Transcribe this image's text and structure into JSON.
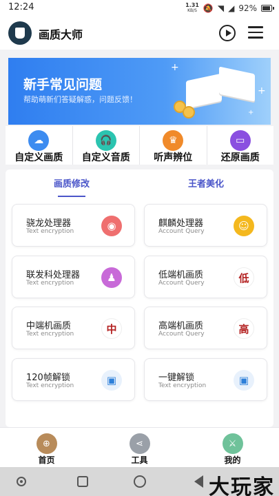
{
  "status_bar": {
    "time": "12:24",
    "net_speed_value": "1.31",
    "net_speed_unit": "KB/S",
    "battery": "92%"
  },
  "app_bar": {
    "title": "画质大师"
  },
  "banner": {
    "title": "新手常见问题",
    "subtitle": "帮助萌新们答疑解惑，问题反馈！"
  },
  "quick_actions": [
    {
      "label": "自定义画质",
      "icon": "cloud-icon",
      "color": "#3d8cf0"
    },
    {
      "label": "自定义音质",
      "icon": "headphones-icon",
      "color": "#2bc4b0"
    },
    {
      "label": "听声辨位",
      "icon": "crown-icon",
      "color": "#f08a2a"
    },
    {
      "label": "还原画质",
      "icon": "monitor-icon",
      "color": "#8a4fe0"
    }
  ],
  "tabs": {
    "left": "画质修改",
    "right": "王者美化"
  },
  "cards": [
    {
      "title": "骁龙处理器",
      "subtitle": "Text encryption",
      "icon": "game-console-icon",
      "icon_color": "#ef6f6f",
      "glyph": "◉"
    },
    {
      "title": "麒麟处理器",
      "subtitle": "Account Query",
      "icon": "cat-face-icon",
      "icon_color": "#f4b81e",
      "glyph": "☺"
    },
    {
      "title": "联发科处理器",
      "subtitle": "Text encryption",
      "icon": "user-icon",
      "icon_color": "#c86ad8",
      "glyph": "♟"
    },
    {
      "title": "低端机画质",
      "subtitle": "Account Query",
      "icon": "low-badge-icon",
      "icon_color": "#b32020",
      "glyph": "低"
    },
    {
      "title": "中端机画质",
      "subtitle": "Text encryption",
      "icon": "mid-badge-icon",
      "icon_color": "#b32020",
      "glyph": "中"
    },
    {
      "title": "高端机画质",
      "subtitle": "Account Query",
      "icon": "high-badge-icon",
      "icon_color": "#b32020",
      "glyph": "高"
    },
    {
      "title": "120帧解锁",
      "subtitle": "Text encryption",
      "icon": "image-icon",
      "icon_color": "#2d7fd9",
      "glyph": "▣"
    },
    {
      "title": "一键解锁",
      "subtitle": "Text encryption",
      "icon": "image-icon",
      "icon_color": "#2d7fd9",
      "glyph": "▣"
    }
  ],
  "bottom_nav": [
    {
      "label": "首页",
      "icon": "gamepad-icon",
      "color": "#b88b5a"
    },
    {
      "label": "工具",
      "icon": "share-icon",
      "color": "#9aa0a8"
    },
    {
      "label": "我的",
      "icon": "sword-icon",
      "color": "#6fc29a"
    }
  ],
  "watermark": "大玩家"
}
